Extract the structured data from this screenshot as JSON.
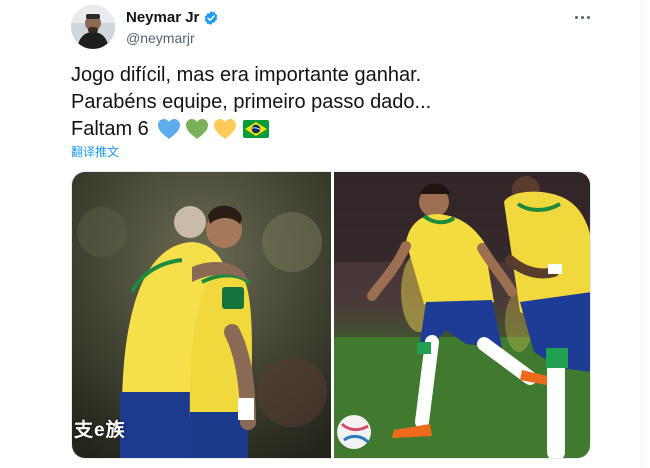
{
  "user": {
    "display_name": "Neymar Jr",
    "handle": "@neymarjr"
  },
  "tweet": {
    "lines": [
      "Jogo difícil, mas era importante ganhar.",
      "Parabéns equipe, primeiro passo dado...",
      "Faltam 6"
    ],
    "emojis": [
      "blue-heart-icon",
      "green-heart-icon",
      "yellow-heart-icon",
      "brazil-flag-icon"
    ],
    "translate_label": "翻译推文"
  },
  "media": {
    "watermark": "支e族"
  },
  "colors": {
    "text": "#0f1419",
    "secondary": "#536471",
    "link": "#1d9bf0",
    "verified": "#1d9bf0",
    "heart_blue": "#5dadec",
    "heart_green": "#78b159",
    "heart_yellow": "#fdcb58",
    "flag_green": "#009b3a",
    "flag_yellow": "#fedf00",
    "flag_blue": "#002776"
  }
}
